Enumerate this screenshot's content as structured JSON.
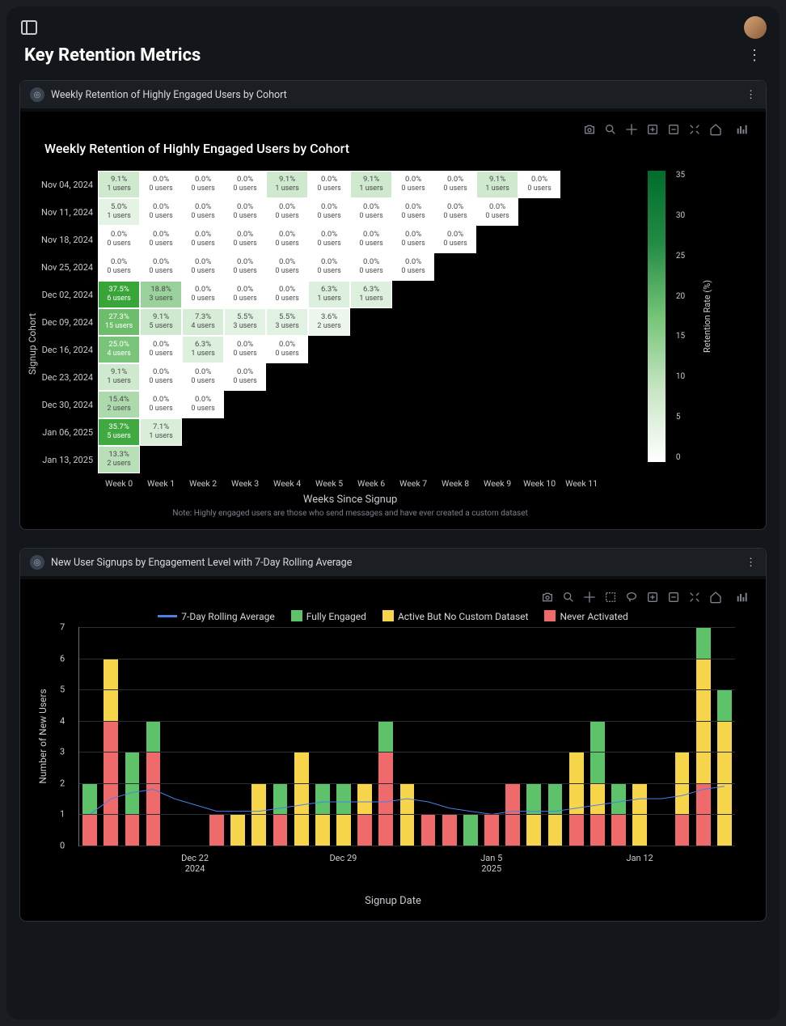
{
  "page": {
    "title": "Key Retention Metrics"
  },
  "panel1": {
    "title": "Weekly Retention of Highly Engaged Users by Cohort"
  },
  "panel2": {
    "title": "New User Signups by Engagement Level with 7-Day Rolling Average"
  },
  "chart_data": [
    {
      "type": "heatmap",
      "title": "Weekly Retention of Highly Engaged Users by Cohort",
      "xlabel": "Weeks Since Signup",
      "ylabel": "Signup Cohort",
      "note": "Note: Highly engaged users are those who send messages and have ever created a custom dataset",
      "x_categories": [
        "Week 0",
        "Week 1",
        "Week 2",
        "Week 3",
        "Week 4",
        "Week 5",
        "Week 6",
        "Week 7",
        "Week 8",
        "Week 9",
        "Week 10",
        "Week 11"
      ],
      "y_categories": [
        "Nov 04, 2024",
        "Nov 11, 2024",
        "Nov 18, 2024",
        "Nov 25, 2024",
        "Dec 02, 2024",
        "Dec 09, 2024",
        "Dec 16, 2024",
        "Dec 23, 2024",
        "Dec 30, 2024",
        "Jan 06, 2025",
        "Jan 13, 2025"
      ],
      "colorbar": {
        "label": "Retention Rate (%)",
        "ticks": [
          0,
          5,
          10,
          15,
          20,
          25,
          30,
          35
        ]
      },
      "cells": [
        [
          {
            "pct": 9.1,
            "users": 1
          },
          {
            "pct": 0.0,
            "users": 0
          },
          {
            "pct": 0.0,
            "users": 0
          },
          {
            "pct": 0.0,
            "users": 0
          },
          {
            "pct": 9.1,
            "users": 1
          },
          {
            "pct": 0.0,
            "users": 0
          },
          {
            "pct": 9.1,
            "users": 1
          },
          {
            "pct": 0.0,
            "users": 0
          },
          {
            "pct": 0.0,
            "users": 0
          },
          {
            "pct": 9.1,
            "users": 1
          },
          {
            "pct": 0.0,
            "users": 0
          }
        ],
        [
          {
            "pct": 5.0,
            "users": 1
          },
          {
            "pct": 0.0,
            "users": 0
          },
          {
            "pct": 0.0,
            "users": 0
          },
          {
            "pct": 0.0,
            "users": 0
          },
          {
            "pct": 0.0,
            "users": 0
          },
          {
            "pct": 0.0,
            "users": 0
          },
          {
            "pct": 0.0,
            "users": 0
          },
          {
            "pct": 0.0,
            "users": 0
          },
          {
            "pct": 0.0,
            "users": 0
          },
          {
            "pct": 0.0,
            "users": 0
          }
        ],
        [
          {
            "pct": 0.0,
            "users": 0
          },
          {
            "pct": 0.0,
            "users": 0
          },
          {
            "pct": 0.0,
            "users": 0
          },
          {
            "pct": 0.0,
            "users": 0
          },
          {
            "pct": 0.0,
            "users": 0
          },
          {
            "pct": 0.0,
            "users": 0
          },
          {
            "pct": 0.0,
            "users": 0
          },
          {
            "pct": 0.0,
            "users": 0
          },
          {
            "pct": 0.0,
            "users": 0
          }
        ],
        [
          {
            "pct": 0.0,
            "users": 0
          },
          {
            "pct": 0.0,
            "users": 0
          },
          {
            "pct": 0.0,
            "users": 0
          },
          {
            "pct": 0.0,
            "users": 0
          },
          {
            "pct": 0.0,
            "users": 0
          },
          {
            "pct": 0.0,
            "users": 0
          },
          {
            "pct": 0.0,
            "users": 0
          },
          {
            "pct": 0.0,
            "users": 0
          }
        ],
        [
          {
            "pct": 37.5,
            "users": 6
          },
          {
            "pct": 18.8,
            "users": 3
          },
          {
            "pct": 0.0,
            "users": 0
          },
          {
            "pct": 0.0,
            "users": 0
          },
          {
            "pct": 0.0,
            "users": 0
          },
          {
            "pct": 6.3,
            "users": 1
          },
          {
            "pct": 6.3,
            "users": 1
          }
        ],
        [
          {
            "pct": 27.3,
            "users": 15
          },
          {
            "pct": 9.1,
            "users": 5
          },
          {
            "pct": 7.3,
            "users": 4
          },
          {
            "pct": 5.5,
            "users": 3
          },
          {
            "pct": 5.5,
            "users": 3
          },
          {
            "pct": 3.6,
            "users": 2
          }
        ],
        [
          {
            "pct": 25.0,
            "users": 4
          },
          {
            "pct": 0.0,
            "users": 0
          },
          {
            "pct": 6.3,
            "users": 1
          },
          {
            "pct": 0.0,
            "users": 0
          },
          {
            "pct": 0.0,
            "users": 0
          }
        ],
        [
          {
            "pct": 9.1,
            "users": 1
          },
          {
            "pct": 0.0,
            "users": 0
          },
          {
            "pct": 0.0,
            "users": 0
          },
          {
            "pct": 0.0,
            "users": 0
          }
        ],
        [
          {
            "pct": 15.4,
            "users": 2
          },
          {
            "pct": 0.0,
            "users": 0
          },
          {
            "pct": 0.0,
            "users": 0
          }
        ],
        [
          {
            "pct": 35.7,
            "users": 5
          },
          {
            "pct": 7.1,
            "users": 1
          }
        ],
        [
          {
            "pct": 13.3,
            "users": 2
          }
        ]
      ]
    },
    {
      "type": "bar",
      "subtype": "stacked-with-line",
      "title": "",
      "xlabel": "Signup Date",
      "ylabel": "Number of New Users",
      "ylim": [
        0,
        7
      ],
      "yticks": [
        0,
        1,
        2,
        3,
        4,
        5,
        6,
        7
      ],
      "x_major_ticks": [
        {
          "label_top": "Dec 22",
          "label_bottom": "2024",
          "index": 5
        },
        {
          "label_top": "Dec 29",
          "label_bottom": "",
          "index": 12
        },
        {
          "label_top": "Jan 5",
          "label_bottom": "2025",
          "index": 19
        },
        {
          "label_top": "Jan 12",
          "label_bottom": "",
          "index": 26
        }
      ],
      "legend": [
        "7-Day Rolling Average",
        "Fully Engaged",
        "Active But No Custom Dataset",
        "Never Activated"
      ],
      "categories_count": 31,
      "series": [
        {
          "name": "Never Activated",
          "color": "#ef6a6a",
          "values": [
            1,
            4,
            1,
            3,
            0,
            0,
            1,
            0,
            0,
            1,
            0,
            0,
            0,
            1,
            3,
            0,
            1,
            1,
            0,
            1,
            2,
            0,
            0,
            1,
            1,
            1,
            0,
            0,
            1,
            2,
            0
          ]
        },
        {
          "name": "Active But No Custom Dataset",
          "color": "#f6d54a",
          "values": [
            0,
            2,
            0,
            0,
            0,
            0,
            0,
            1,
            2,
            0,
            3,
            1,
            1,
            1,
            0,
            2,
            0,
            0,
            0,
            0,
            0,
            1,
            1,
            2,
            1,
            0,
            2,
            0,
            2,
            4,
            4
          ]
        },
        {
          "name": "Fully Engaged",
          "color": "#5ec26a",
          "values": [
            1,
            0,
            2,
            1,
            0,
            0,
            0,
            0,
            0,
            1,
            0,
            1,
            1,
            0,
            1,
            0,
            0,
            0,
            1,
            0,
            0,
            1,
            1,
            0,
            2,
            1,
            0,
            0,
            0,
            1,
            1
          ]
        }
      ],
      "line_series": {
        "name": "7-Day Rolling Average",
        "color": "#4a7fe8",
        "values": [
          1.0,
          1.5,
          1.7,
          1.8,
          1.5,
          1.3,
          1.1,
          1.1,
          1.1,
          1.2,
          1.3,
          1.4,
          1.4,
          1.4,
          1.4,
          1.5,
          1.4,
          1.2,
          1.1,
          1.0,
          1.1,
          1.1,
          1.1,
          1.2,
          1.3,
          1.4,
          1.5,
          1.5,
          1.6,
          1.8,
          1.9
        ]
      }
    }
  ]
}
